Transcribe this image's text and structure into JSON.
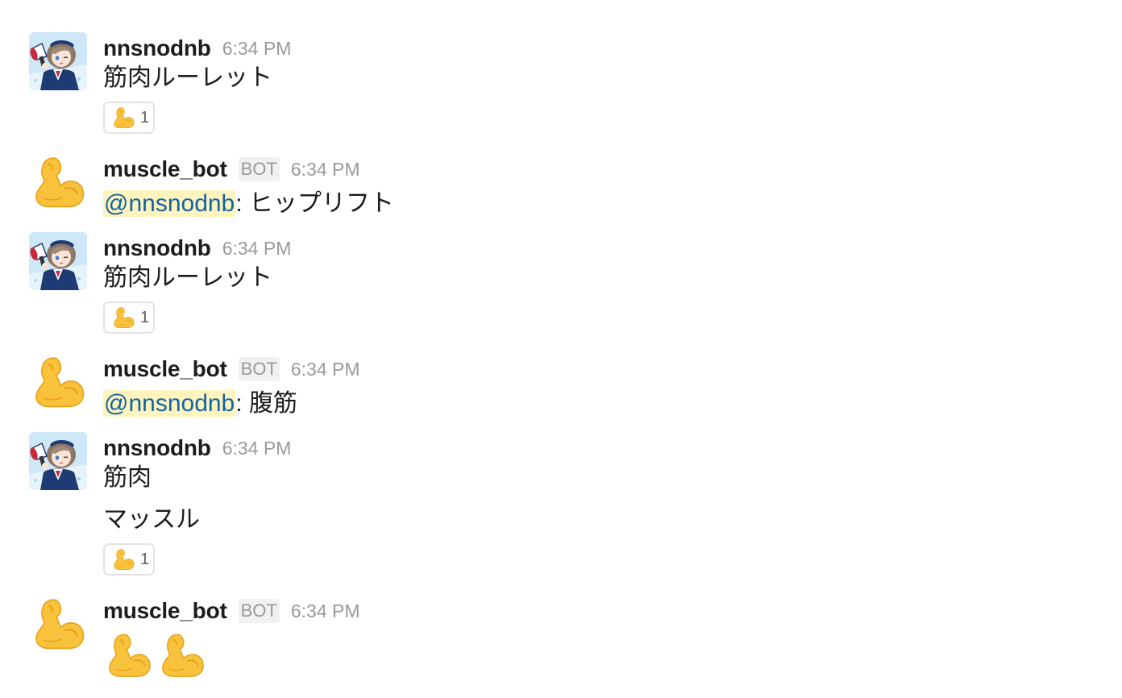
{
  "accent_colors": {
    "mention_bg": "#fff4be",
    "mention_text": "#1264a3",
    "muted_text": "#9a9a9a",
    "emoji_yellow": "#f9c23c"
  },
  "messages": [
    {
      "user": "nnsnodnb",
      "is_bot": false,
      "time": "6:34 PM",
      "lines": [
        "筋肉ルーレット"
      ],
      "reaction": {
        "icon": "flexed-biceps-icon",
        "count": "1"
      }
    },
    {
      "user": "muscle_bot",
      "is_bot": true,
      "bot_label": "BOT",
      "time": "6:34 PM",
      "mention": "@nnsnodnb",
      "text_after_mention": ": ヒップリフト"
    },
    {
      "user": "nnsnodnb",
      "is_bot": false,
      "time": "6:34 PM",
      "lines": [
        "筋肉ルーレット"
      ],
      "reaction": {
        "icon": "flexed-biceps-icon",
        "count": "1"
      }
    },
    {
      "user": "muscle_bot",
      "is_bot": true,
      "bot_label": "BOT",
      "time": "6:34 PM",
      "mention": "@nnsnodnb",
      "text_after_mention": ": 腹筋"
    },
    {
      "user": "nnsnodnb",
      "is_bot": false,
      "time": "6:34 PM",
      "lines": [
        "筋肉",
        "マッスル"
      ],
      "reaction": {
        "icon": "flexed-biceps-icon",
        "count": "1"
      }
    },
    {
      "user": "muscle_bot",
      "is_bot": true,
      "bot_label": "BOT",
      "time": "6:34 PM",
      "emoji_message": [
        "flexed-biceps-icon",
        "flexed-biceps-icon"
      ]
    }
  ]
}
